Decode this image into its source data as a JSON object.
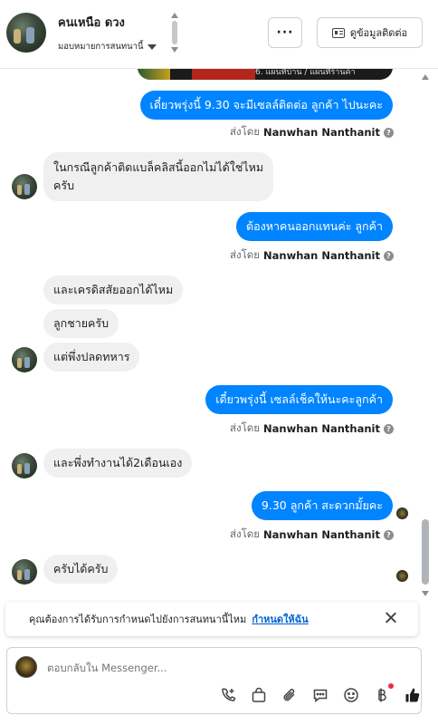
{
  "header": {
    "contact_name": "คนเหนือ ดวง",
    "assign_label": "มอบหมายการสนทนานี้",
    "more_label": "···",
    "contact_info_label": "ดูข้อมูลติดต่อ"
  },
  "chat": {
    "image_strip_text": "6. แผนที่บ้าน / แผนที่ร้านค้า",
    "sent_by_prefix": "ส่งโดย",
    "messages": [
      {
        "dir": "out",
        "text": "เดี๋ยวพรุ่งนี้ 9.30 จะมีเซลล์ติดต่อ ลูกค้า ไปนะคะ",
        "sender": "Nanwhan Nanthanit"
      },
      {
        "dir": "in",
        "lines": [
          "ในกรณีลูกค้าติดแบล็คลิสนี้ออกไม่ได้ใช่ไหม",
          "ครับ"
        ]
      },
      {
        "dir": "out",
        "text": "ต้องหาคนออกแทนค่ะ  ลูกค้า",
        "sender": "Nanwhan Nanthanit"
      },
      {
        "dir": "in",
        "text": "และเครดิสสัยออกได้ไหม"
      },
      {
        "dir": "in",
        "text": "ลูกชายครับ"
      },
      {
        "dir": "in",
        "text": "แต่พึ่งปลดทหาร"
      },
      {
        "dir": "out",
        "text": "เดี๋ยวพรุ่งนี้ เซลล์เช็คให้นะคะลูกค้า",
        "sender": "Nanwhan Nanthanit"
      },
      {
        "dir": "in",
        "text": "และพึ่งทำงานได้2เดือนเอง"
      },
      {
        "dir": "out",
        "text": "9.30 ลูกค้า สะดวกมั้ยคะ",
        "sender": "Nanwhan Nanthanit"
      },
      {
        "dir": "in",
        "text": "ครับได้ครับ"
      }
    ]
  },
  "banner": {
    "text": "คุณต้องการได้รับการกำหนดไปยังการสนทนานี้ไหม",
    "link": "กำหนดให้ฉัน"
  },
  "composer": {
    "placeholder": "ตอบกลับใน Messenger..."
  },
  "icons": [
    "phone-add-icon",
    "shopping-bag-icon",
    "paperclip-icon",
    "chat-bubble-icon",
    "emoji-icon",
    "baht-icon",
    "thumbs-up-icon"
  ],
  "colors": {
    "accent": "#0084ff",
    "link": "#0064d1",
    "incoming_bubble": "#f0f0f0",
    "notification": "#f02849"
  }
}
